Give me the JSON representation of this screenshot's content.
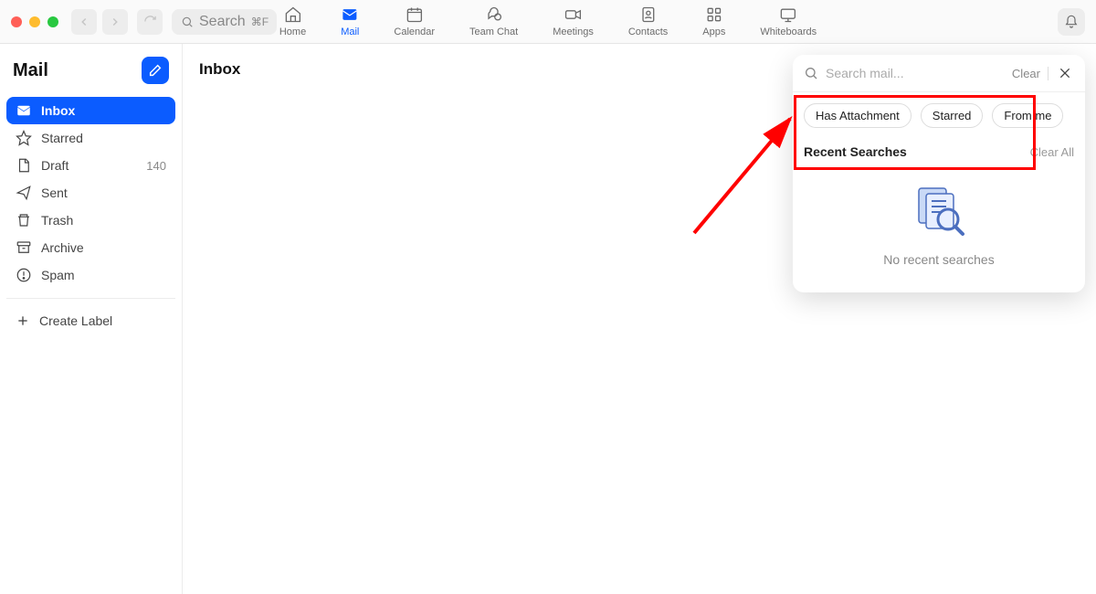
{
  "topbar": {
    "search_placeholder": "Search",
    "search_shortcut": "⌘F",
    "nav": [
      {
        "label": "Home"
      },
      {
        "label": "Mail"
      },
      {
        "label": "Calendar"
      },
      {
        "label": "Team Chat"
      },
      {
        "label": "Meetings"
      },
      {
        "label": "Contacts"
      },
      {
        "label": "Apps"
      },
      {
        "label": "Whiteboards"
      }
    ]
  },
  "sidebar": {
    "title": "Mail",
    "folders": {
      "inbox": "Inbox",
      "starred": "Starred",
      "draft": "Draft",
      "draft_count": "140",
      "sent": "Sent",
      "trash": "Trash",
      "archive": "Archive",
      "spam": "Spam"
    },
    "create_label": "Create Label"
  },
  "main": {
    "heading": "Inbox"
  },
  "search_panel": {
    "placeholder": "Search mail...",
    "clear": "Clear",
    "filters": {
      "has_attachment": "Has Attachment",
      "starred": "Starred",
      "from_me": "From me"
    },
    "recent_title": "Recent Searches",
    "clear_all": "Clear All",
    "empty_msg": "No recent searches"
  }
}
